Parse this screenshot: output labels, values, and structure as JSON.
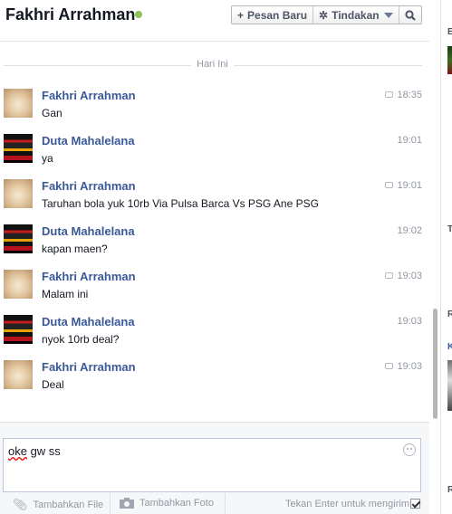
{
  "header": {
    "contact_name": "Fakhri Arrahman",
    "status": "online",
    "new_message_label": "Pesan Baru",
    "actions_label": "Tindakan",
    "icons": [
      "plus-icon",
      "gear-icon",
      "chevron-down-icon",
      "search-icon"
    ]
  },
  "thread": {
    "date_divider": "Hari Ini",
    "messages": [
      {
        "sender": "Fakhri Arrahman",
        "text": "Gan",
        "time": "18:35",
        "seen_icon": true
      },
      {
        "sender": "Duta Mahalelana",
        "text": "ya",
        "time": "19:01",
        "seen_icon": false
      },
      {
        "sender": "Fakhri Arrahman",
        "text": "Taruhan bola yuk 10rb Via Pulsa Barca Vs PSG Ane PSG",
        "time": "19:01",
        "seen_icon": true
      },
      {
        "sender": "Duta Mahalelana",
        "text": "kapan maen?",
        "time": "19:02",
        "seen_icon": false
      },
      {
        "sender": "Fakhri Arrahman",
        "text": "Malam ini",
        "time": "19:03",
        "seen_icon": true
      },
      {
        "sender": "Duta Mahalelana",
        "text": "nyok 10rb deal?",
        "time": "19:03",
        "seen_icon": false
      },
      {
        "sender": "Fakhri Arrahman",
        "text": "Deal",
        "time": "19:03",
        "seen_icon": true
      }
    ]
  },
  "composer": {
    "value_word1": "oke",
    "value_rest": " gw ss",
    "add_file_label": "Tambahkan File",
    "add_photo_label": "Tambahkan Foto",
    "enter_to_send_label": "Tekan Enter untuk mengirim",
    "enter_to_send_checked": true
  },
  "right_panel": {
    "letters": [
      "E",
      "T",
      "R",
      "K",
      "R"
    ]
  },
  "colors": {
    "sender_name": "#3b5998",
    "online": "#8ac454",
    "muted": "#9197a3"
  }
}
